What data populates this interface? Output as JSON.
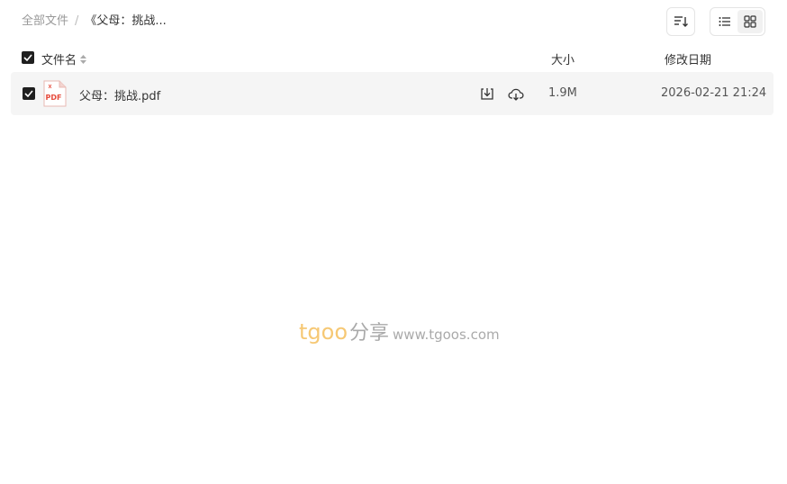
{
  "breadcrumb": {
    "root": "全部文件",
    "separator": "/",
    "current": "《父母：挑战..."
  },
  "toolbar": {
    "sort_icon": "sort-lines-icon",
    "list_view_icon": "list-view-icon",
    "grid_view_icon": "grid-view-icon"
  },
  "columns": {
    "name": "文件名",
    "size": "大小",
    "modified": "修改日期"
  },
  "files": [
    {
      "name": "父母：挑战.pdf",
      "type_label": "PDF",
      "size": "1.9M",
      "modified": "2026-02-21 21:24",
      "selected": true
    }
  ],
  "watermark": {
    "brand": "tgoo",
    "brand_cn": "分享",
    "url": "www.tgoos.com"
  },
  "colors": {
    "checkbox": "#1f1f1f",
    "row_bg": "#f5f5f5",
    "pdf_red": "#e64a3b",
    "watermark_orange": "#f6c874",
    "watermark_gray": "#aaaaaa"
  }
}
